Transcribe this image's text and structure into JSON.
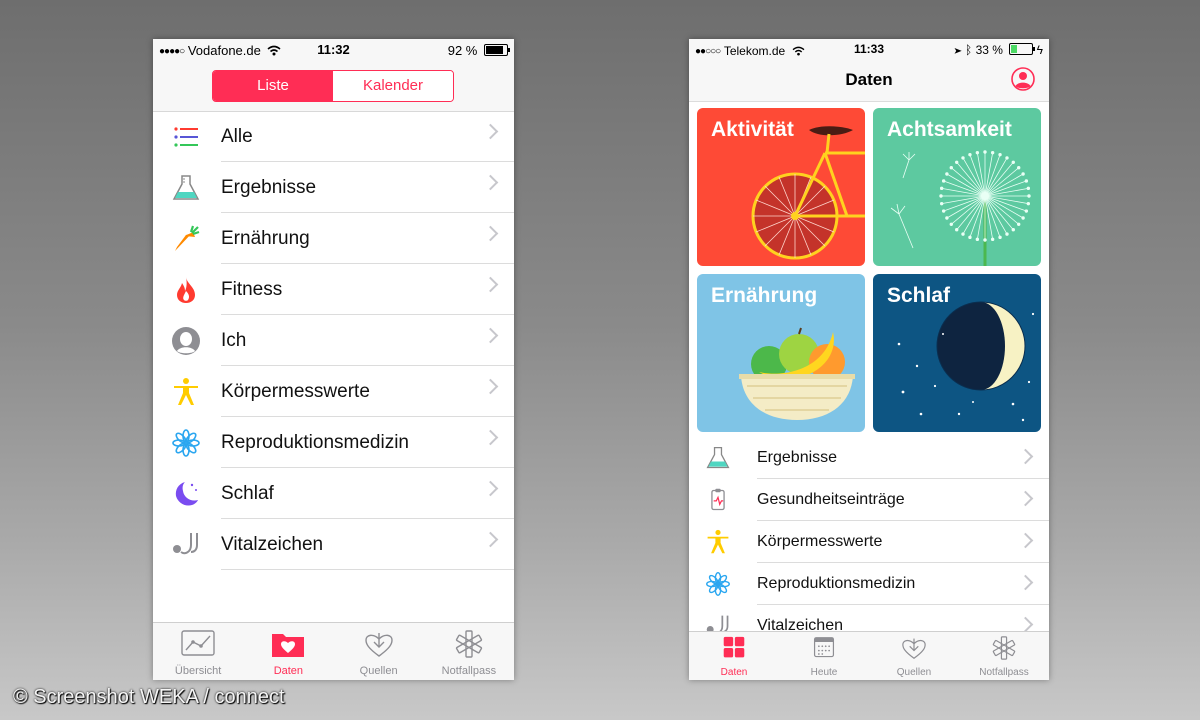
{
  "left_phone": {
    "status": {
      "carrier": "Vodafone.de",
      "time": "11:32",
      "battery": "92 %",
      "battery_level": 0.92
    },
    "segments": [
      "Liste",
      "Kalender"
    ],
    "active_segment": "Liste",
    "list": [
      {
        "label": "Alle",
        "icon": "list-icon"
      },
      {
        "label": "Ergebnisse",
        "icon": "flask-icon"
      },
      {
        "label": "Ernährung",
        "icon": "carrot-icon"
      },
      {
        "label": "Fitness",
        "icon": "flame-icon"
      },
      {
        "label": "Ich",
        "icon": "person-icon"
      },
      {
        "label": "Körpermesswerte",
        "icon": "body-icon"
      },
      {
        "label": "Reproduktionsmedizin",
        "icon": "flower-icon"
      },
      {
        "label": "Schlaf",
        "icon": "moon-icon"
      },
      {
        "label": "Vitalzeichen",
        "icon": "stethoscope-icon"
      }
    ],
    "tabs": [
      {
        "label": "Übersicht",
        "icon": "chart-icon",
        "active": false
      },
      {
        "label": "Daten",
        "icon": "folder-heart-icon",
        "active": true
      },
      {
        "label": "Quellen",
        "icon": "download-heart-icon",
        "active": false
      },
      {
        "label": "Notfallpass",
        "icon": "asterisk-icon",
        "active": false
      }
    ]
  },
  "right_phone": {
    "status": {
      "carrier": "Telekom.de",
      "time": "11:33",
      "battery": "33 %",
      "battery_level": 0.33
    },
    "title": "Daten",
    "tiles": [
      {
        "label": "Aktivität",
        "color": "#fe4a36"
      },
      {
        "label": "Achtsamkeit",
        "color": "#5dc9a0"
      },
      {
        "label": "Ernährung",
        "color": "#7fc4e6"
      },
      {
        "label": "Schlaf",
        "color": "#0d5583"
      }
    ],
    "list": [
      {
        "label": "Ergebnisse",
        "icon": "flask-icon"
      },
      {
        "label": "Gesundheitseinträge",
        "icon": "clipboard-icon"
      },
      {
        "label": "Körpermesswerte",
        "icon": "body-icon"
      },
      {
        "label": "Reproduktionsmedizin",
        "icon": "flower-icon"
      },
      {
        "label": "Vitalzeichen",
        "icon": "stethoscope-icon"
      }
    ],
    "tabs": [
      {
        "label": "Daten",
        "icon": "grid-icon",
        "active": true
      },
      {
        "label": "Heute",
        "icon": "calendar-icon",
        "active": false
      },
      {
        "label": "Quellen",
        "icon": "download-heart-icon",
        "active": false
      },
      {
        "label": "Notfallpass",
        "icon": "asterisk-icon",
        "active": false
      }
    ]
  },
  "accent_color": "#ff2d55",
  "caption": "© Screenshot WEKA / connect"
}
